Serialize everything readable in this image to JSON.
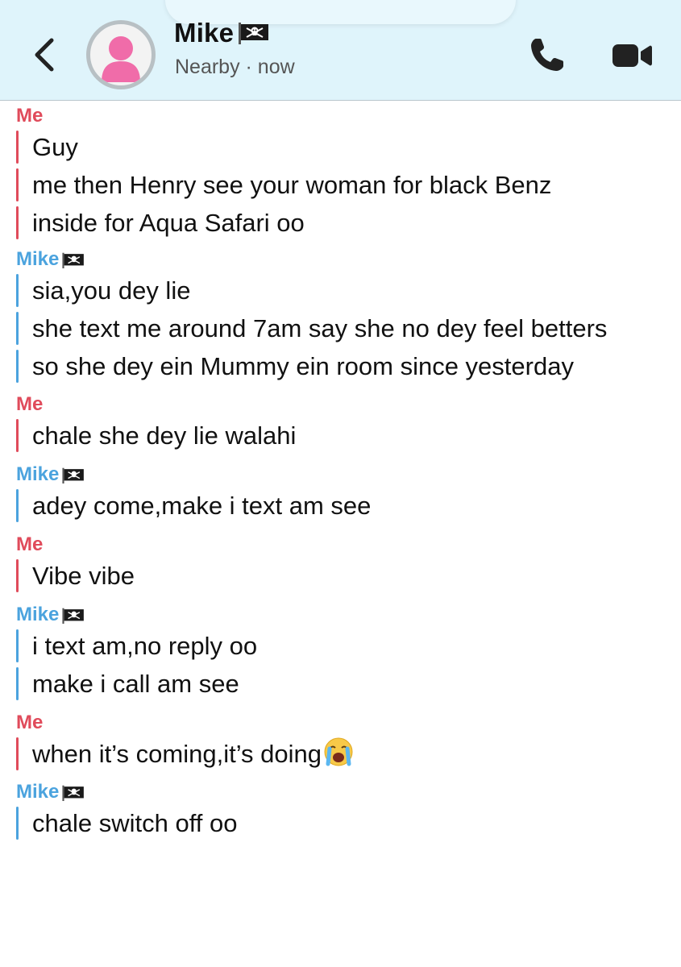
{
  "header": {
    "contact_name": "Mike",
    "status": "Nearby · now"
  },
  "icons": {
    "back": "chevron-left-icon",
    "call": "phone-icon",
    "video": "video-camera-icon",
    "flag": "pirate-flag-emoji",
    "crying": "loudly-crying-face-emoji"
  },
  "colors": {
    "header_bg": "#dff4fb",
    "me": "#e04b5b",
    "mike": "#4ba3de",
    "avatar_fill": "#f06ca9"
  },
  "messages": [
    {
      "sender": "Me",
      "who": "me",
      "lines": [
        "Guy",
        "me then Henry see your woman for black Benz",
        "inside for Aqua Safari oo"
      ]
    },
    {
      "sender": "Mike",
      "who": "mike",
      "lines": [
        "sia,you dey lie",
        "she text me around 7am say she no dey feel betters",
        "so she dey ein Mummy ein room since yesterday"
      ]
    },
    {
      "sender": "Me",
      "who": "me",
      "lines": [
        "chale she dey lie walahi"
      ]
    },
    {
      "sender": "Mike",
      "who": "mike",
      "lines": [
        "adey come,make i text am see"
      ]
    },
    {
      "sender": "Me",
      "who": "me",
      "lines": [
        "Vibe vibe"
      ]
    },
    {
      "sender": "Mike",
      "who": "mike",
      "lines": [
        "i text am,no reply oo",
        "make i call am see"
      ]
    },
    {
      "sender": "Me",
      "who": "me",
      "lines": [
        "when it’s coming,it’s doing"
      ]
    },
    {
      "sender": "Mike",
      "who": "mike",
      "lines": [
        "chale switch off oo"
      ]
    }
  ]
}
